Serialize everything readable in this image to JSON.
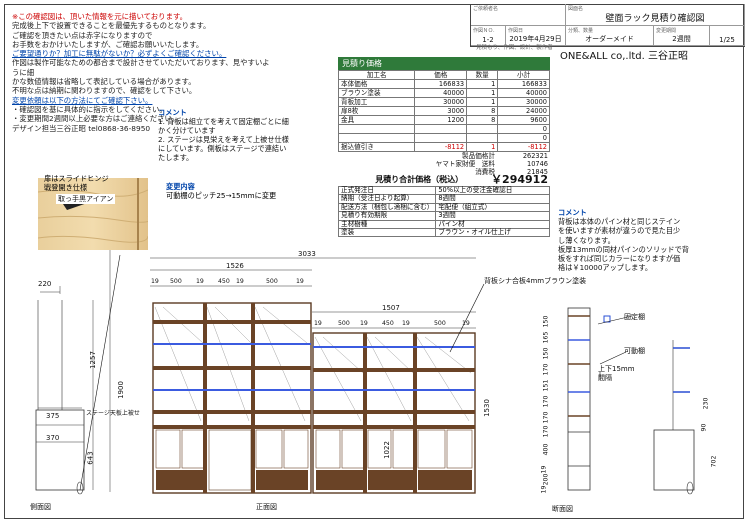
{
  "notes": {
    "lines": [
      {
        "text": "※この確認図は、頂いた情報を元に描いております。",
        "style": "r"
      },
      {
        "text": "完成後上下で設置できることを最優先するものとなります。",
        "style": ""
      },
      {
        "text": "ご確認を頂きたい点は赤字になりますので",
        "style": ""
      },
      {
        "text": "お手数をおかけいたしますが、ご確認お願いいたします。",
        "style": ""
      },
      {
        "text": "ご要望通りか？加工に無駄がないか？必ずよくご確認ください。",
        "style": "b"
      },
      {
        "text": "作図は製作可能なための都合まで設計させていただいております、見やすいように細",
        "style": ""
      },
      {
        "text": "かな数値情報は省略して表記している場合があります。",
        "style": ""
      },
      {
        "text": "不明な点は納期に関わりますので、確認をして下さい。",
        "style": ""
      },
      {
        "text": "変更依頼は以下の方法にてご確認下さい。",
        "style": "b"
      },
      {
        "text": "・確認図を基に具体的に指示をしてください。",
        "style": ""
      },
      {
        "text": "・変更期間2週間以上必要な方はご連絡ください。",
        "style": ""
      },
      {
        "text": "デザイン担当三谷正昭 tel0868-36-8950",
        "style": ""
      }
    ]
  },
  "header": {
    "customer_label": "ご依頼者名",
    "drawing_label": "図面名",
    "drawing_name": "壁面ラック見積り確認図",
    "order_label": "作図ＮＯ.",
    "order_no": "1-2",
    "date_label": "作図日",
    "date": "2019年4月29日",
    "category_label": "分類、数量",
    "category": "オーダーメイド",
    "lead_label": "変更期間",
    "lead": "2週間",
    "page": "1/25",
    "maker_label": "見積もり、作図、設計、製作者",
    "maker": "ONE&ALL co,.ltd. 三谷正昭"
  },
  "estimate": {
    "title": "見積り価格",
    "columns": [
      "加工名",
      "価格",
      "数量",
      "小計"
    ],
    "rows": [
      {
        "name": "本体価格",
        "price": "166833",
        "qty": "1",
        "subtotal": "166833",
        "red": false
      },
      {
        "name": "ブラウン塗装",
        "price": "40000",
        "qty": "1",
        "subtotal": "40000",
        "red": false
      },
      {
        "name": "背板加工",
        "price": "30000",
        "qty": "1",
        "subtotal": "30000",
        "red": false
      },
      {
        "name": "扉8枚",
        "price": "3000",
        "qty": "8",
        "subtotal": "24000",
        "red": false
      },
      {
        "name": "金具",
        "price": "1200",
        "qty": "8",
        "subtotal": "9600",
        "red": false
      },
      {
        "name": "",
        "price": "",
        "qty": "",
        "subtotal": "0",
        "red": false
      },
      {
        "name": "",
        "price": "",
        "qty": "",
        "subtotal": "0",
        "red": false
      },
      {
        "name": "据込値引き",
        "price": "-8112",
        "qty": "1",
        "subtotal": "-8112",
        "red": true
      }
    ],
    "summary": [
      {
        "label": "製品価格計",
        "value": "262321"
      },
      {
        "label": "ヤマト家財便　送料",
        "value": "10746"
      },
      {
        "label": "消費税",
        "value": "21845"
      }
    ],
    "total_label": "見積り合計価格（税込）",
    "total_value": "￥294912"
  },
  "conditions": [
    {
      "label": "正式発注日",
      "value": "50%以上の受注金確認日"
    },
    {
      "label": "納期（受注日より起算）",
      "value": "8週間"
    },
    {
      "label": "配送方法（梱包し適梱に含む）",
      "value": "宅配便（組立式）"
    },
    {
      "label": "見積り有効期限",
      "value": "3週間"
    },
    {
      "label": "主材樹種",
      "value": "パイン材"
    },
    {
      "label": "塗装",
      "value": "ブラウン・オイル仕上げ"
    }
  ],
  "comment1": {
    "title": "コメント",
    "lines": [
      "1. 背板は組立てを考えて固定棚ごとに細",
      "かく分けています",
      "2. ステージは見栄えを考えて上被せ仕様",
      "にしています。側板はステージで連結い",
      "たします。"
    ]
  },
  "change": {
    "title": "変更内容",
    "text": "可動棚のピッチ25→15mmに変更"
  },
  "photo_caption": {
    "line1": "扉はスライドヒンジ",
    "line2": "戦登開き仕様",
    "line3": "取っ手黒アイアン"
  },
  "comment2": {
    "title": "コメント",
    "lines": [
      "背板は本体のパイン材と同じステイン",
      "を使いますが素材が違うので見た目少",
      "し薄くなります。",
      "板厚13mmの同材パインのソリッドで背",
      "板をすれば同じカラーになりますが価",
      "格は￥10000アップします。"
    ]
  },
  "labels": {
    "back_board": "背板シナ合板4mmブラウン塗装",
    "fixed_shelf": "固定棚",
    "movable_shelf": "可動棚",
    "pitch": "上下15mm",
    "pitch2": "間隔",
    "stage": "ステージ天板上被せ",
    "side_view": "側面図",
    "front_view": "正面図",
    "section_view": "断面図"
  },
  "dims": {
    "overall_width": "3033",
    "left_width": "1526",
    "right_width": "1507",
    "left_cols": [
      "19",
      "500",
      "19",
      "450",
      "19",
      "500",
      "19"
    ],
    "right_cols": [
      "19",
      "500",
      "19",
      "450",
      "19",
      "500",
      "19"
    ],
    "side_depth": "220",
    "side_375": "375",
    "side_370": "370",
    "height_1900": "1900",
    "height_1257": "1257",
    "height_643": "643",
    "height_1530": "1530",
    "height_1022": "1022",
    "section_heights": [
      "150",
      "165",
      "150",
      "170",
      "151",
      "170",
      "170",
      "170",
      "400",
      "19",
      "200",
      "19"
    ],
    "section_right": [
      "230",
      "90",
      "702",
      "308"
    ]
  }
}
